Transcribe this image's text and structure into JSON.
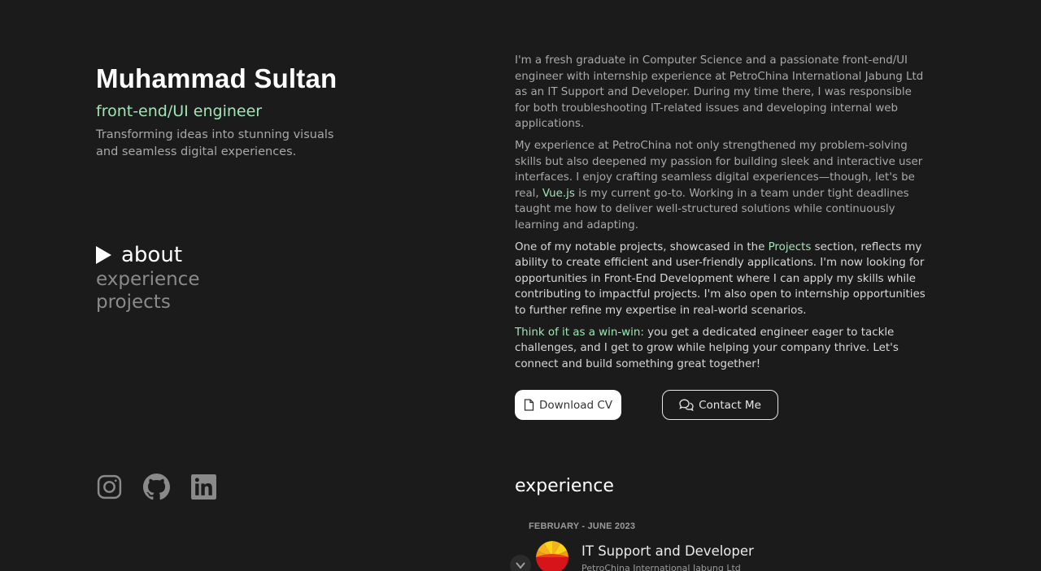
{
  "profile": {
    "name": "Muhammad Sultan",
    "role": "front-end/UI engineer",
    "tagline": "Transforming ideas into stunning visuals and seamless digital experiences."
  },
  "nav": {
    "items": [
      {
        "label": "about",
        "active": true
      },
      {
        "label": "experience",
        "active": false
      },
      {
        "label": "projects",
        "active": false
      }
    ]
  },
  "socials": [
    {
      "icon": "instagram-icon"
    },
    {
      "icon": "github-icon"
    },
    {
      "icon": "linkedin-icon"
    }
  ],
  "about": {
    "p1": "I'm a fresh graduate in Computer Science and a passionate front-end/UI engineer with internship experience at PetroChina International Jabung Ltd as an IT Support and Developer. During my time there, I was responsible for both troubleshooting IT-related issues and developing internal web applications.",
    "p2_a": "My experience at PetroChina not only strengthened my problem-solving skills but also deepened my passion for building sleek and interactive user interfaces. I enjoy crafting seamless digital experiences—though, let's be real, ",
    "p2_link": "Vue.js",
    "p2_b": " is my current go-to. Working in a team under tight deadlines taught me how to deliver well-structured solutions while continuously learning and adapting.",
    "p3_a": "One of my notable projects, showcased in the ",
    "p3_link": "Projects",
    "p3_b": " section, reflects my ability to create efficient and user-friendly applications. I'm now looking for opportunities in Front-End Development where I can apply my skills while contributing to impactful projects. I'm also open to internship opportunities to further refine my expertise in real-world scenarios.",
    "p4_accent": "Think of it as a win-win:",
    "p4_b": " you get a dedicated engineer eager to tackle challenges, and I get to grow while helping your company thrive. Let's connect and build something great together!"
  },
  "buttons": {
    "download": "Download CV",
    "contact": "Contact Me"
  },
  "experience": {
    "title": "experience",
    "items": [
      {
        "date": "FEBRUARY - JUNE 2023",
        "role": "IT Support and Developer",
        "company": "PetroChina International Jabung Ltd"
      }
    ]
  },
  "colors": {
    "background": "#1b1b1b",
    "accent": "#9ee6b3"
  }
}
